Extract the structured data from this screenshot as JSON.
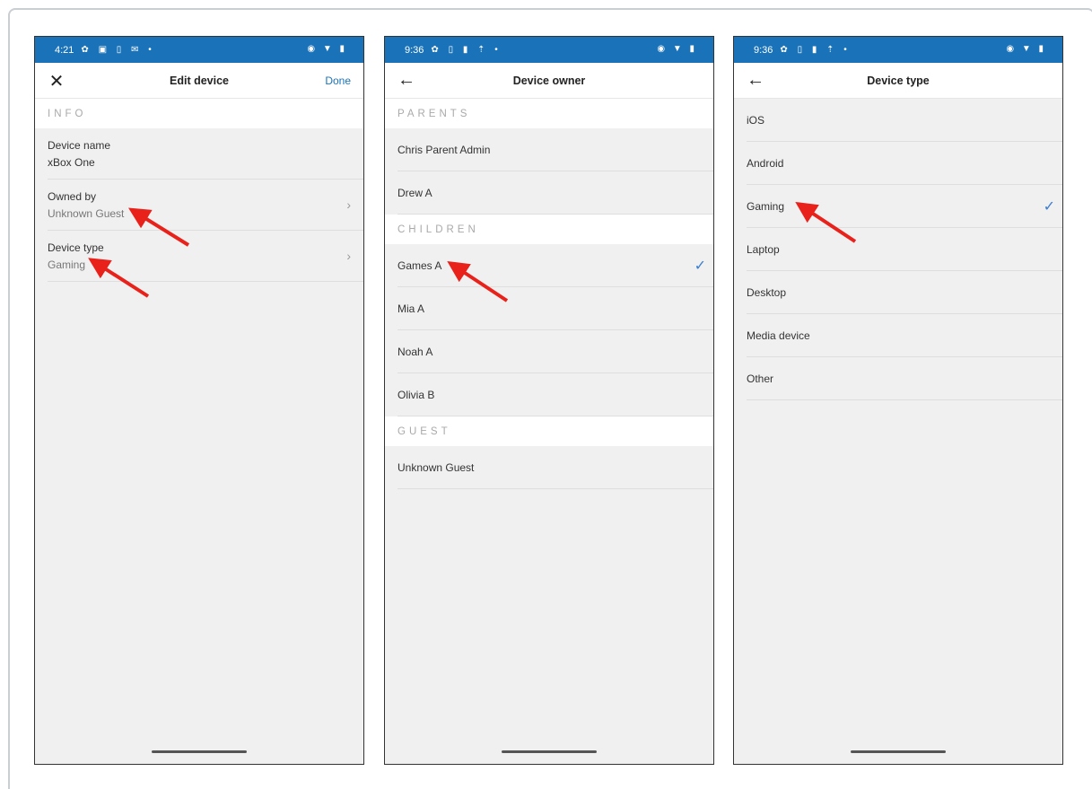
{
  "screens": [
    {
      "status": {
        "time": "4:21",
        "icons": "✿ ▣ ▯ ✉ •",
        "right": "◉ ▼ ▮"
      },
      "appbar": {
        "lead_icon": "✕",
        "title": "Edit device",
        "action": "Done"
      },
      "section_info": "INFO",
      "device_name": {
        "label": "Device name",
        "value": "xBox One"
      },
      "owned_by": {
        "label": "Owned by",
        "value": "Unknown Guest"
      },
      "device_type": {
        "label": "Device type",
        "value": "Gaming"
      },
      "chevron": "›"
    },
    {
      "status": {
        "time": "9:36",
        "icons": "✿ ▯ ▮ ⇡ •",
        "right": "◉ ▼ ▮"
      },
      "appbar": {
        "lead_icon": "←",
        "title": "Device owner"
      },
      "sections": {
        "parents": "PARENTS",
        "children": "CHILDREN",
        "guest": "GUEST"
      },
      "parents": [
        "Chris Parent Admin",
        "Drew A"
      ],
      "children": [
        "Games A",
        "Mia A",
        "Noah A",
        "Olivia B"
      ],
      "guest": [
        "Unknown Guest"
      ],
      "selected": "Games A",
      "check": "✓"
    },
    {
      "status": {
        "time": "9:36",
        "icons": "✿ ▯ ▮ ⇡ •",
        "right": "◉ ▼ ▮"
      },
      "appbar": {
        "lead_icon": "←",
        "title": "Device type"
      },
      "types": [
        "iOS",
        "Android",
        "Gaming",
        "Laptop",
        "Desktop",
        "Media device",
        "Other"
      ],
      "selected": "Gaming",
      "check": "✓"
    }
  ],
  "annotation_color": "#e8211b"
}
